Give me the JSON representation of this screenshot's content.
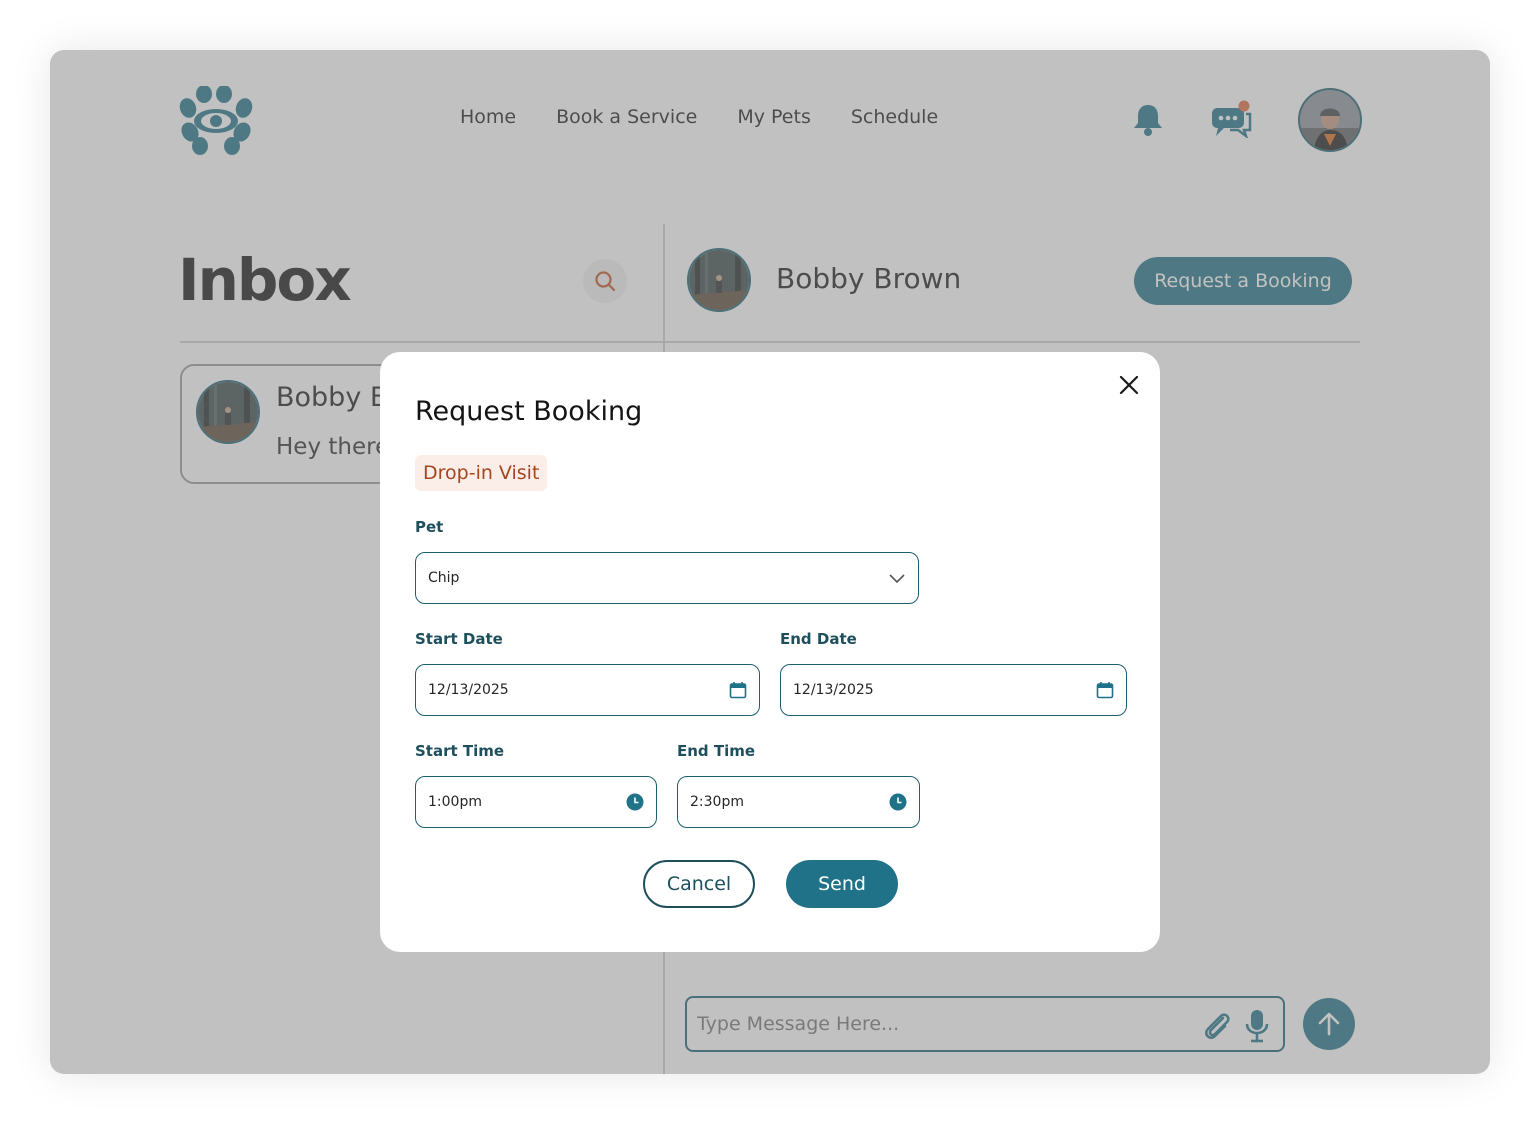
{
  "nav": {
    "items": [
      "Home",
      "Book a Service",
      "My Pets",
      "Schedule"
    ]
  },
  "icons": {
    "logo": "paw-eye-logo",
    "bell": "bell-icon",
    "messages": "chat-bubbles-icon",
    "search": "search-icon"
  },
  "colors": {
    "brand": "#1f7287",
    "accent": "#e0683a",
    "tag_text": "#a4461d",
    "tag_bg": "#fbeee9"
  },
  "inbox": {
    "title": "Inbox",
    "conversations": [
      {
        "name": "Bobby B",
        "preview": "Hey there"
      }
    ]
  },
  "chat": {
    "contact_name": "Bobby Brown",
    "request_button": "Request a Booking",
    "input_placeholder": "Type Message Here..."
  },
  "modal": {
    "title": "Request Booking",
    "service_tag": "Drop-in Visit",
    "pet_label": "Pet",
    "pet_value": "Chip",
    "start_date_label": "Start Date",
    "start_date_value": "12/13/2025",
    "end_date_label": "End Date",
    "end_date_value": "12/13/2025",
    "start_time_label": "Start Time",
    "start_time_value": "1:00pm",
    "end_time_label": "End Time",
    "end_time_value": "2:30pm",
    "cancel_label": "Cancel",
    "send_label": "Send"
  }
}
